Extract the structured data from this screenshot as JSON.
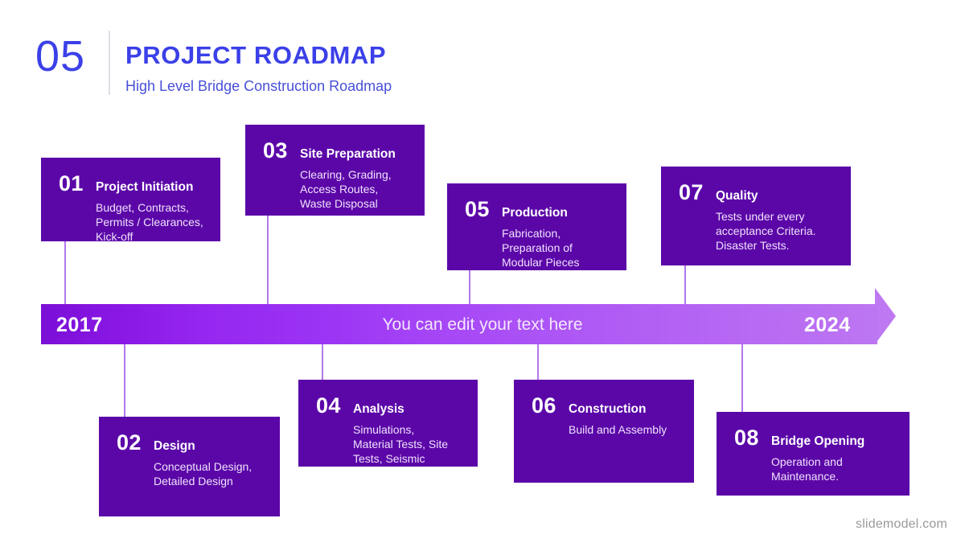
{
  "header": {
    "section_number": "05",
    "title": "PROJECT ROADMAP",
    "subtitle": "High Level Bridge Construction Roadmap",
    "accent_color": "#3B40E8"
  },
  "timeline": {
    "start_year": "2017",
    "end_year": "2024",
    "center_text": "You can edit your text here",
    "gradient_from": "#7A0FD6",
    "gradient_to": "#BD76F2"
  },
  "milestones": [
    {
      "number": "01",
      "title": "Project Initiation",
      "description": "Budget, Contracts,\nPermits / Clearances,\nKick-off",
      "position": "above"
    },
    {
      "number": "02",
      "title": "Design",
      "description": "Conceptual Design,\nDetailed Design",
      "position": "below"
    },
    {
      "number": "03",
      "title": "Site Preparation",
      "description": "Clearing, Grading,\nAccess Routes,\nWaste Disposal",
      "position": "above"
    },
    {
      "number": "04",
      "title": "Analysis",
      "description": "Simulations,\nMaterial Tests, Site\nTests, Seismic",
      "position": "below"
    },
    {
      "number": "05",
      "title": "Production",
      "description": "Fabrication,\nPreparation of\nModular Pieces",
      "position": "above"
    },
    {
      "number": "06",
      "title": "Construction",
      "description": "Build and Assembly",
      "position": "below"
    },
    {
      "number": "07",
      "title": "Quality",
      "description": "Tests under every\nacceptance Criteria.\nDisaster Tests.",
      "position": "above"
    },
    {
      "number": "08",
      "title": "Bridge Opening",
      "description": "Operation and\nMaintenance.",
      "position": "below"
    }
  ],
  "footer": {
    "watermark": "slidemodel.com"
  },
  "card_color": "#5B07A8"
}
